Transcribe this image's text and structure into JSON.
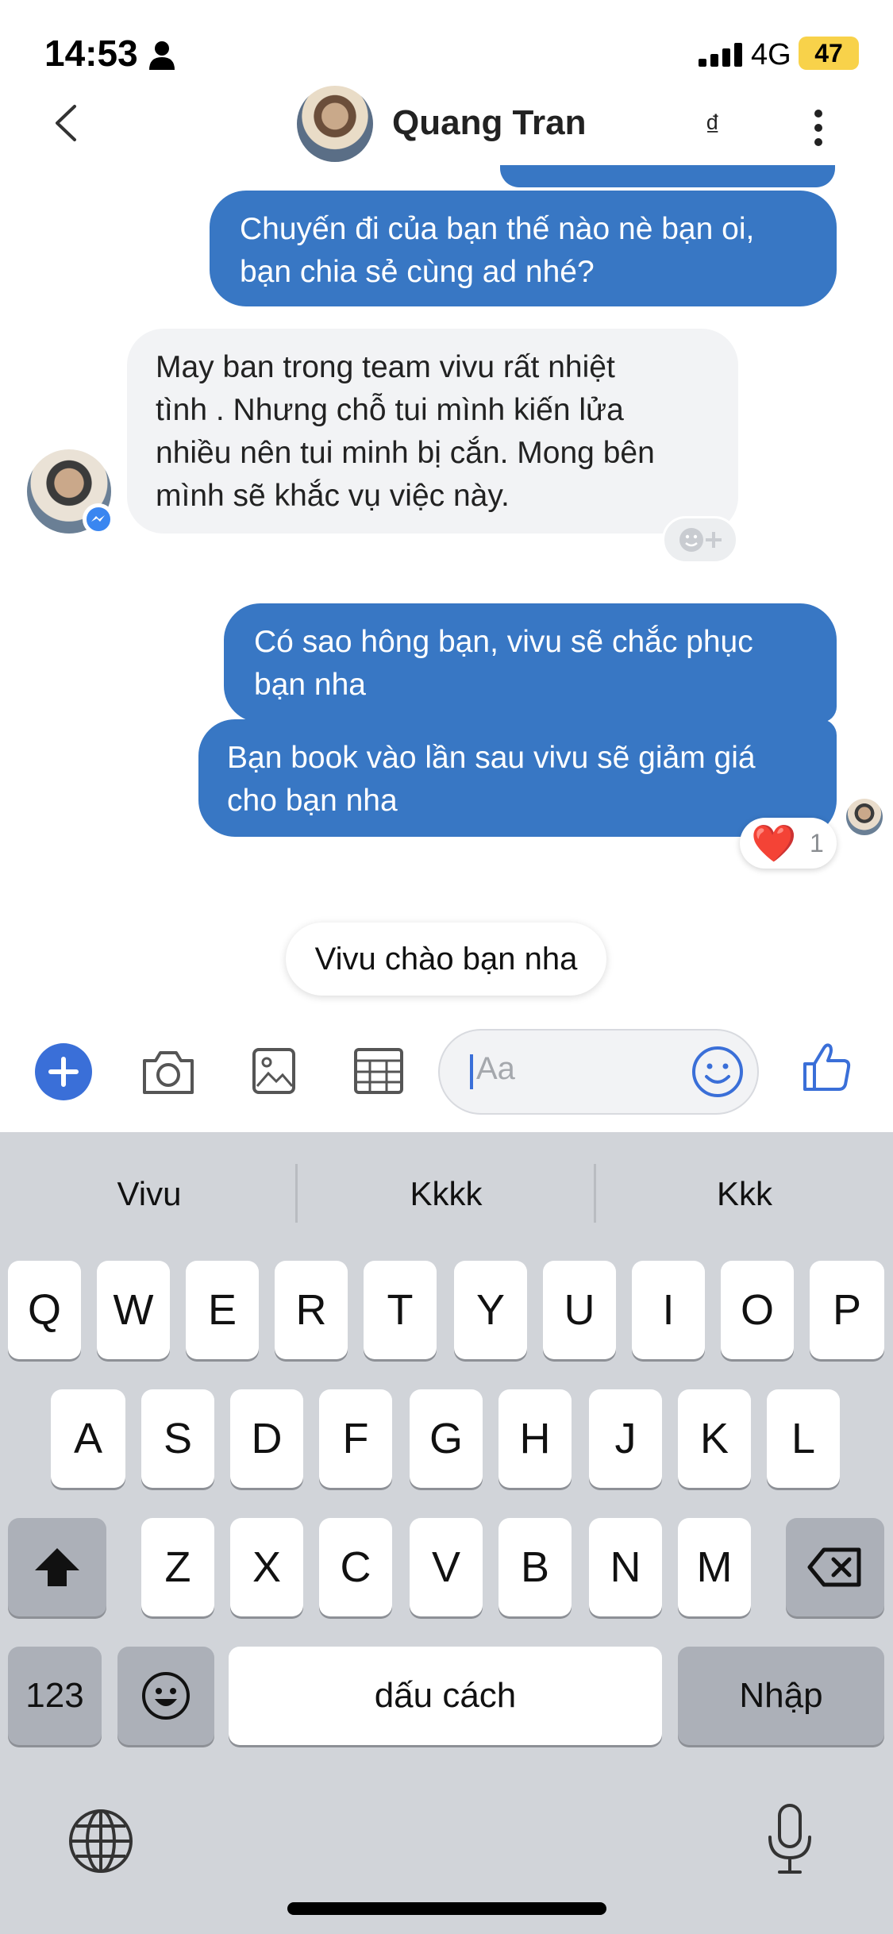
{
  "status_bar": {
    "time": "14:53",
    "network": "4G",
    "battery": "47"
  },
  "header": {
    "contact_name": "Quang Tran",
    "currency_icon": "₫"
  },
  "messages": [
    {
      "direction": "out",
      "lines": [
        "Chuyến đi của bạn thế nào nè bạn oi,",
        "bạn chia sẻ cùng ad nhé?"
      ]
    },
    {
      "direction": "in",
      "lines": [
        "May ban trong team vivu rất nhiệt",
        "tình . Nhưng chỗ tui mình kiến lửa",
        "nhiều nên tui minh bị cắn. Mong bên",
        "mình sẽ khắc vụ việc này."
      ]
    },
    {
      "direction": "out",
      "lines": [
        "Có sao hông bạn, vivu sẽ chắc phục",
        "bạn nha"
      ]
    },
    {
      "direction": "out",
      "lines": [
        "Bạn book vào lần sau vivu sẽ giảm giá",
        "cho bạn nha"
      ]
    }
  ],
  "reaction": {
    "emoji": "❤️",
    "count": "1"
  },
  "quick_reply": "Vivu chào bạn nha",
  "composer": {
    "placeholder": "Aa"
  },
  "keyboard": {
    "suggestions": [
      "Vivu",
      "Kkkk",
      "Kkk"
    ],
    "row1": [
      "Q",
      "W",
      "E",
      "R",
      "T",
      "Y",
      "U",
      "I",
      "O",
      "P"
    ],
    "row2": [
      "A",
      "S",
      "D",
      "F",
      "G",
      "H",
      "J",
      "K",
      "L"
    ],
    "row3": [
      "Z",
      "X",
      "C",
      "V",
      "B",
      "N",
      "M"
    ],
    "numbers_key": "123",
    "space_key": "dấu cách",
    "return_key": "Nhập"
  },
  "colors": {
    "outgoing_bubble": "#3877c4",
    "accent": "#3a6fd8",
    "heart": "#e0282e"
  }
}
